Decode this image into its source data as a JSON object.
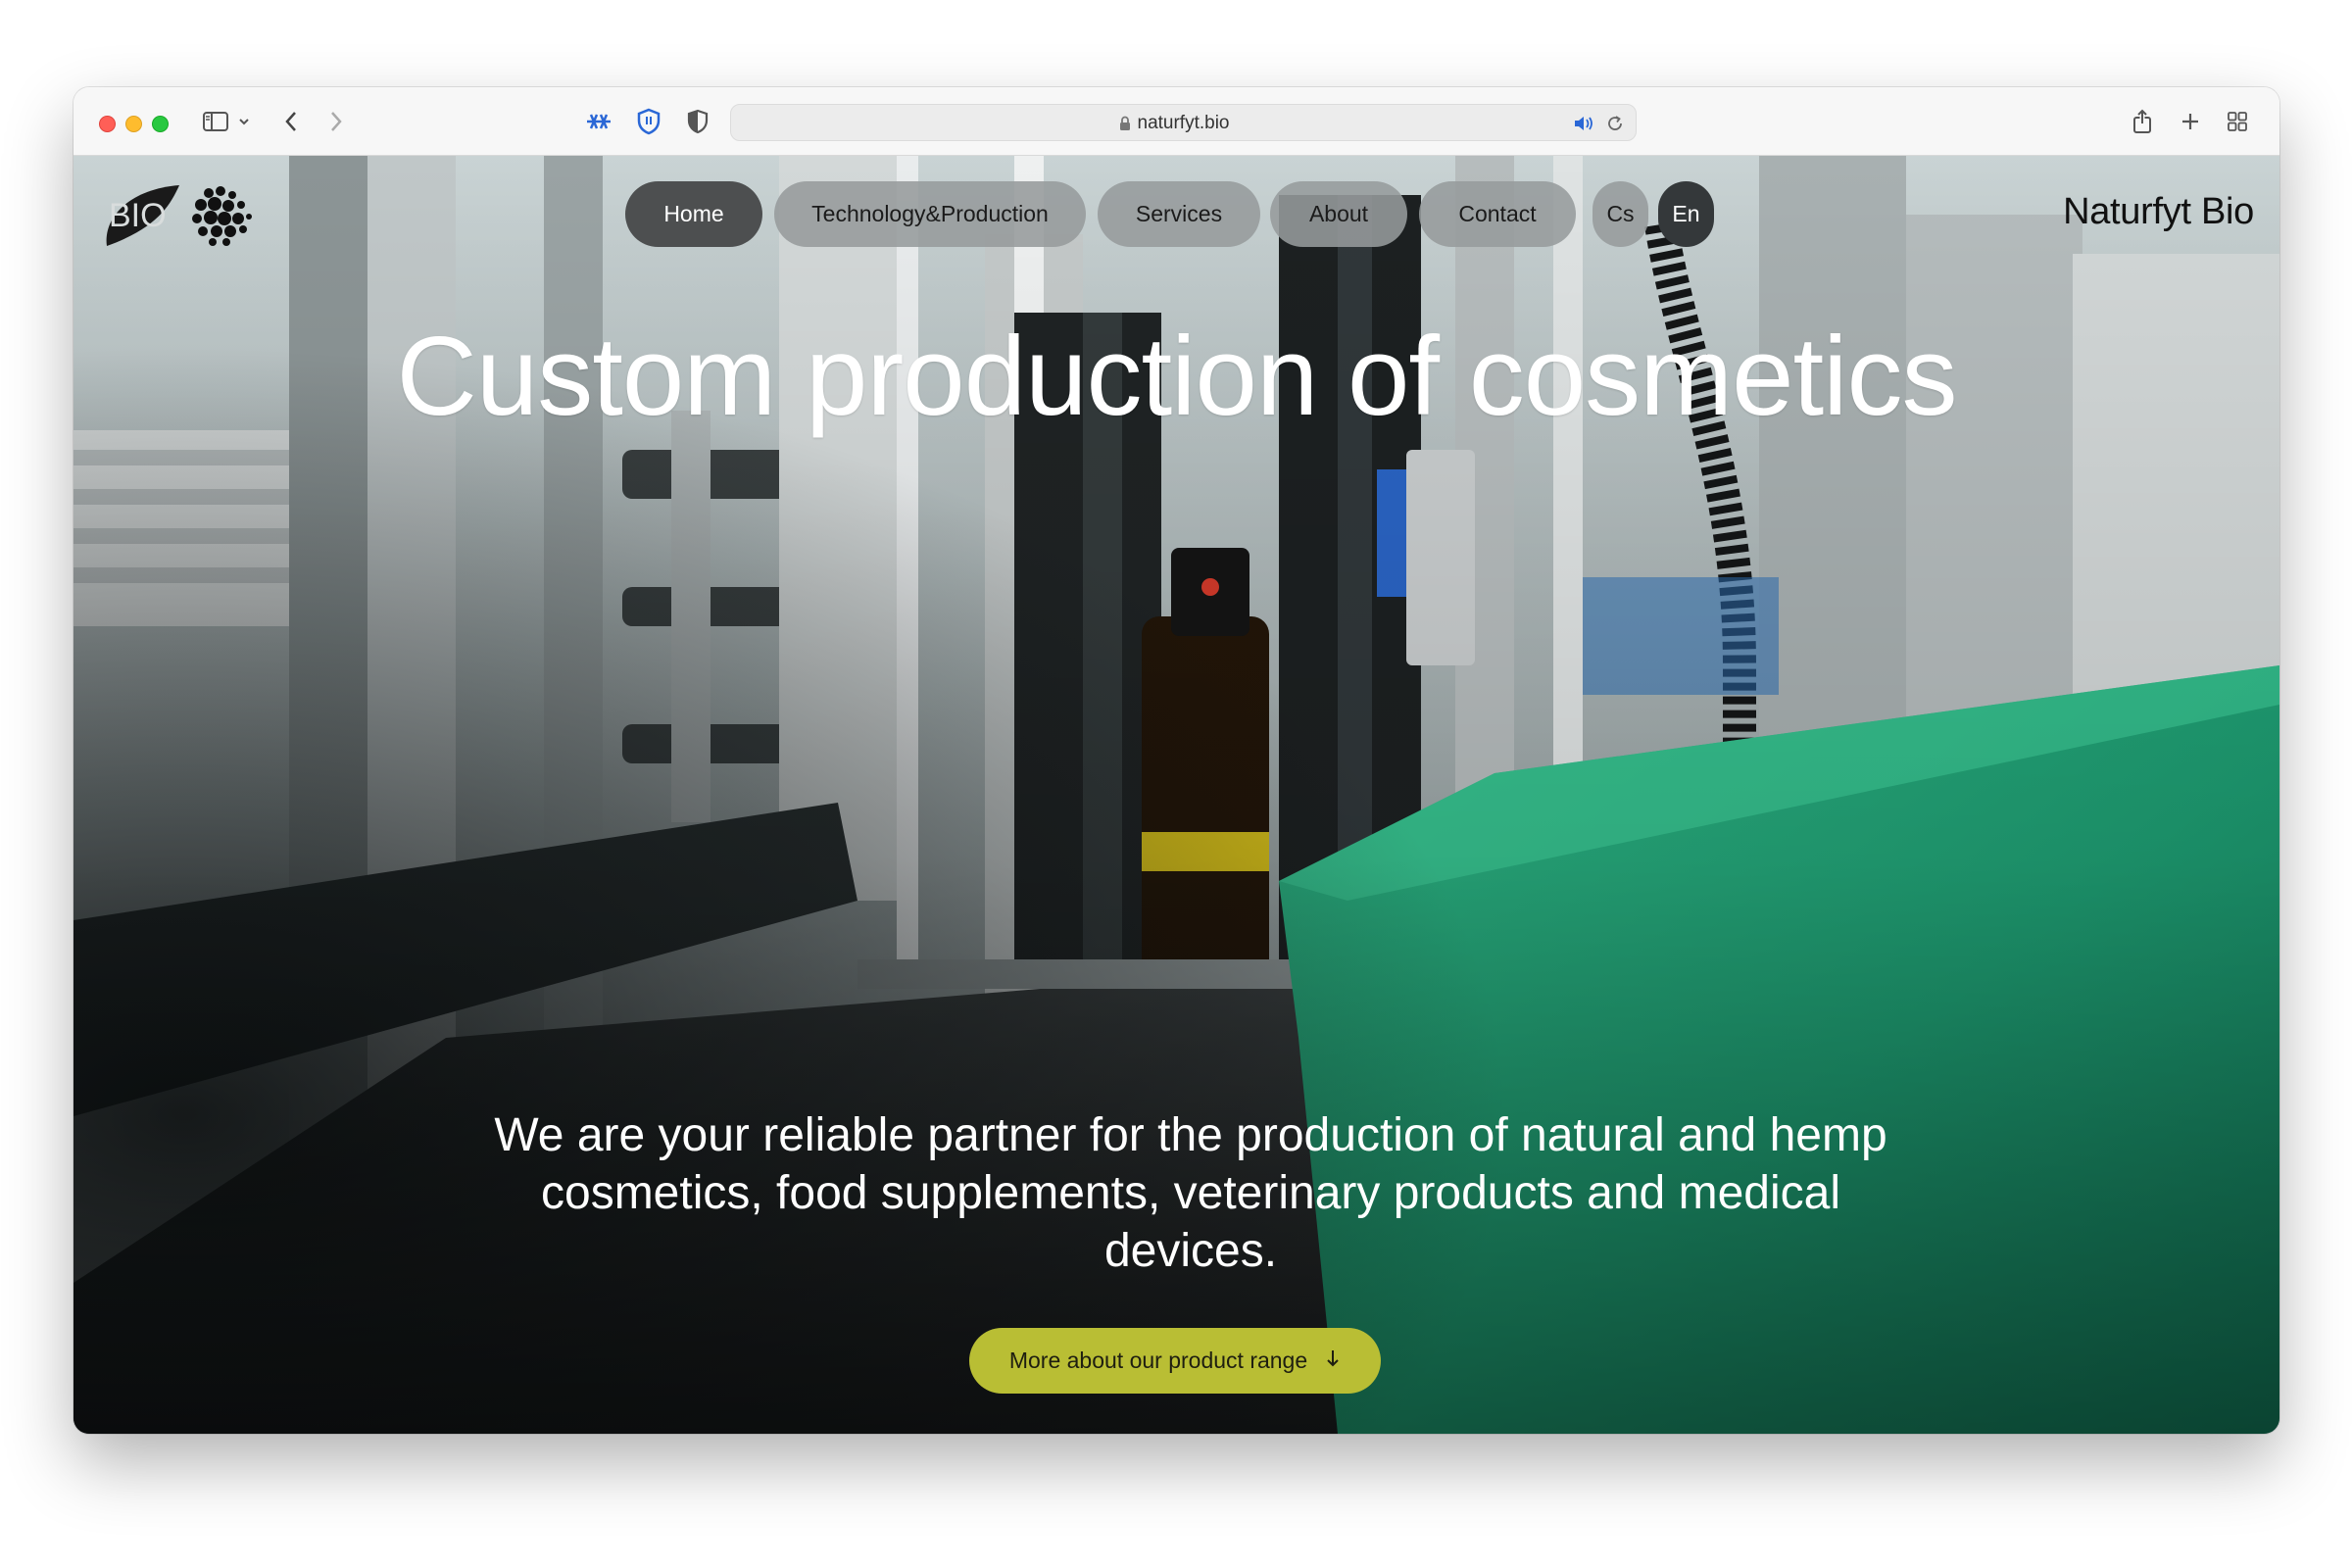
{
  "browser": {
    "url": "naturfyt.bio",
    "traffic_lights": [
      "close",
      "minimize",
      "zoom"
    ],
    "left_icons": [
      "sidebar-icon",
      "chevron-down-icon",
      "back-arrow-icon",
      "forward-arrow-icon"
    ],
    "extension_icons": [
      "snowflake-extension-icon",
      "shield-extension-icon",
      "privacy-shield-icon"
    ],
    "address_icons": [
      "lock-icon",
      "speaker-icon",
      "reload-icon"
    ],
    "right_icons": [
      "share-icon",
      "new-tab-icon",
      "tab-overview-icon"
    ]
  },
  "site": {
    "brand": "Naturfyt Bio",
    "logo_text": "BIO",
    "nav": [
      {
        "label": "Home",
        "active": true
      },
      {
        "label": "Technology&Production",
        "active": false
      },
      {
        "label": "Services",
        "active": false
      },
      {
        "label": "About",
        "active": false
      },
      {
        "label": "Contact",
        "active": false
      }
    ],
    "languages": [
      {
        "label": "Cs",
        "active": false
      },
      {
        "label": "En",
        "active": true
      }
    ]
  },
  "hero": {
    "headline": "Custom production of cosmetics",
    "subline": "We are your reliable partner for the production of natural and hemp cosmetics, food supplements, veterinary products and medical devices.",
    "cta_label": "More about our product range",
    "cta_icon": "arrow-down-icon"
  },
  "colors": {
    "cta_background": "#b9be34",
    "nav_active": "#4d4f50",
    "nav_inactive": "#96999b",
    "accent_green": "#1fa27a"
  }
}
